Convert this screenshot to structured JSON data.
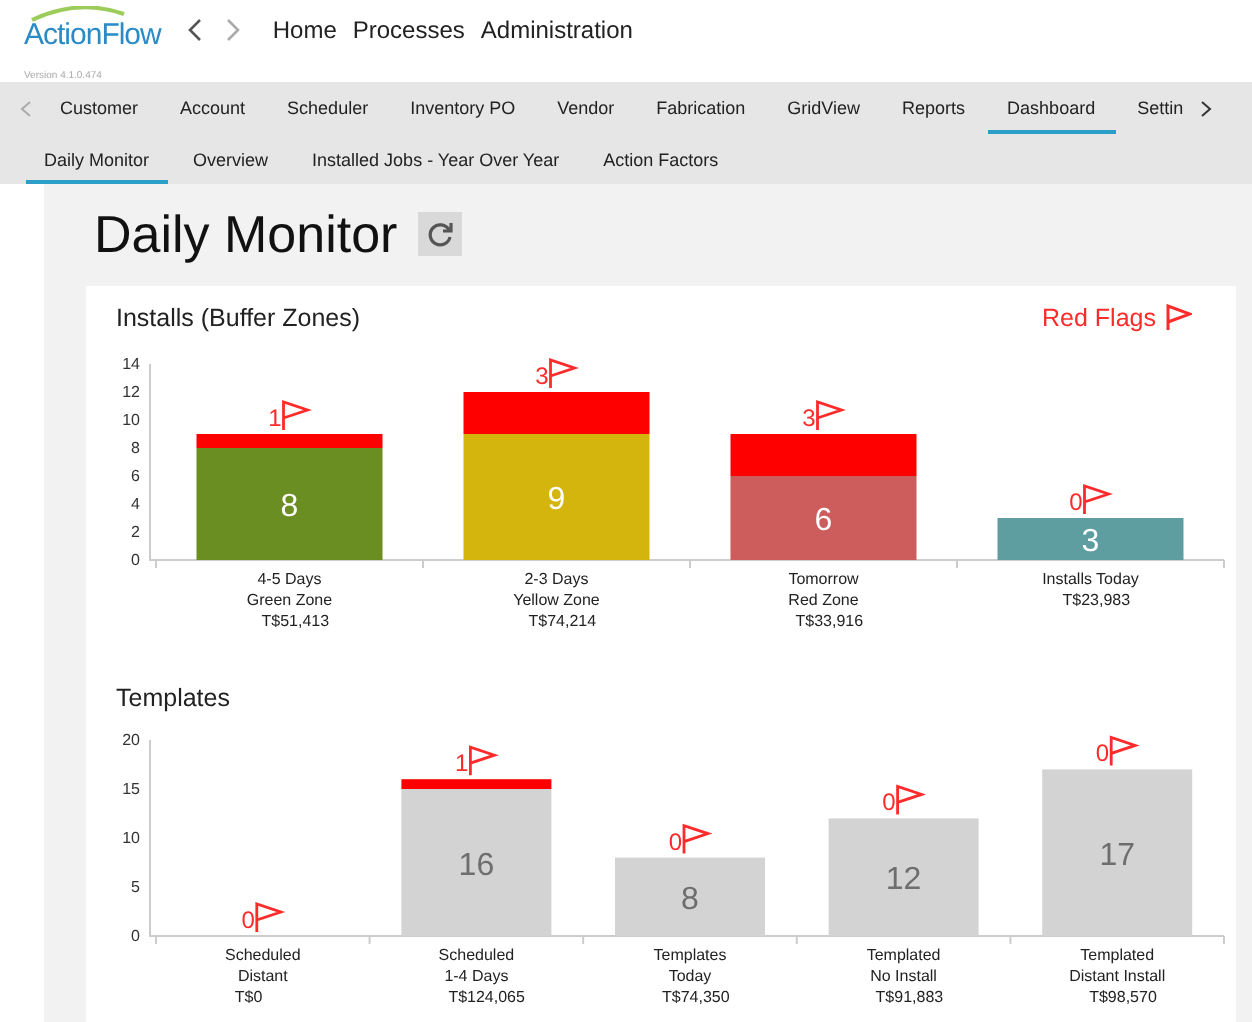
{
  "app": {
    "logo": "ActionFlow",
    "version": "Version 4.1.0.474",
    "nav": [
      "Home",
      "Processes",
      "Administration"
    ]
  },
  "tabs": [
    {
      "label": "Customer",
      "selected": false
    },
    {
      "label": "Account",
      "selected": false
    },
    {
      "label": "Scheduler",
      "selected": false
    },
    {
      "label": "Inventory PO",
      "selected": false
    },
    {
      "label": "Vendor",
      "selected": false
    },
    {
      "label": "Fabrication",
      "selected": false
    },
    {
      "label": "GridView",
      "selected": false
    },
    {
      "label": "Reports",
      "selected": false
    },
    {
      "label": "Dashboard",
      "selected": true
    },
    {
      "label": "Settin",
      "selected": false
    }
  ],
  "subtabs": [
    {
      "label": "Daily Monitor",
      "selected": true
    },
    {
      "label": "Overview",
      "selected": false
    },
    {
      "label": "Installed Jobs - Year Over Year",
      "selected": false
    },
    {
      "label": "Action Factors",
      "selected": false
    }
  ],
  "page_title": "Daily Monitor",
  "installs": {
    "title": "Installs (Buffer Zones)",
    "bars": [
      {
        "amount": "T$51,413",
        "value_label": "8",
        "flags": "1"
      },
      {
        "amount": "T$74,214",
        "value_label": "9",
        "flags": "3"
      },
      {
        "amount": "T$33,916",
        "value_label": "6",
        "flags": "3"
      },
      {
        "amount": "T$23,983",
        "value_label": "3",
        "flags": "0"
      }
    ],
    "chart_data": {
      "type": "bar",
      "stacked": true,
      "categories": [
        "4-5 Days\nGreen Zone",
        "2-3 Days\nYellow Zone",
        "Tomorrow\nRed Zone",
        "Installs Today"
      ],
      "series": [
        {
          "colors": [
            "#6b8e23",
            "#d4b50e",
            "#cd5c5c",
            "#5f9ea0"
          ],
          "values": [
            8,
            9,
            6,
            3
          ]
        },
        {
          "name": "Red Flags",
          "color": "#ff0000",
          "values": [
            1,
            3,
            3,
            0
          ]
        }
      ],
      "ylim": [
        0,
        14
      ],
      "yticks": [
        0,
        2,
        4,
        6,
        8,
        10,
        12,
        14
      ]
    }
  },
  "templates": {
    "title": "Templates",
    "bars": [
      {
        "amount": "T$0",
        "flags": "0"
      },
      {
        "amount": "T$124,065",
        "value_label": "16",
        "flags": "1"
      },
      {
        "amount": "T$74,350",
        "value_label": "8",
        "flags": "0"
      },
      {
        "amount": "T$91,883",
        "value_label": "12",
        "flags": "0"
      },
      {
        "amount": "T$98,570",
        "value_label": "17",
        "flags": "0"
      }
    ],
    "chart_data": {
      "type": "bar",
      "stacked": true,
      "categories": [
        "Scheduled\nDistant",
        "Scheduled\n1-4 Days",
        "Templates\nToday",
        "Templated\nNo Install",
        "Templated\nDistant Install"
      ],
      "series": [
        {
          "color": "#d3d3d3",
          "values": [
            0,
            15,
            8,
            12,
            17
          ]
        },
        {
          "color": "#ff0000",
          "values": [
            0,
            1,
            0,
            0,
            0
          ]
        }
      ],
      "ylim": [
        0,
        20
      ],
      "yticks": [
        0,
        5,
        10,
        15,
        20
      ]
    }
  }
}
